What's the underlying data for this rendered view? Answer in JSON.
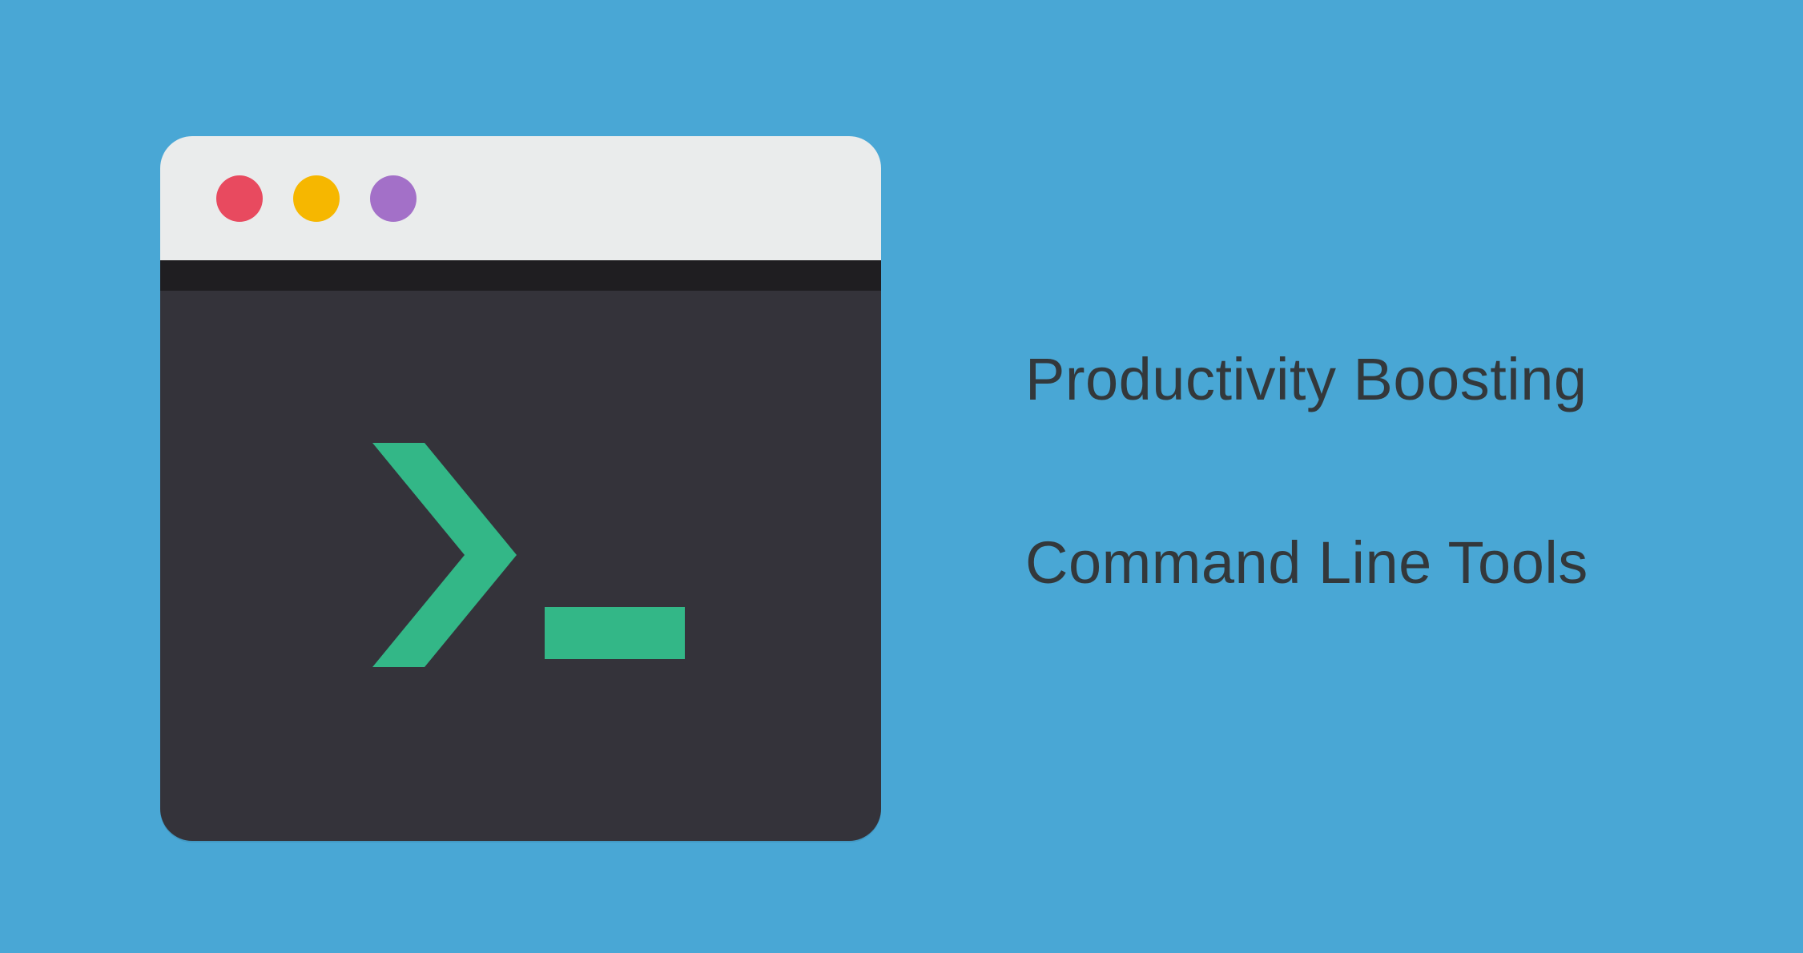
{
  "heading": {
    "line1": "Productivity Boosting",
    "line2": "Command Line Tools"
  },
  "colors": {
    "background": "#49a7d5",
    "titlebar": "#eaecec",
    "terminal_body": "#34333a",
    "prompt_green": "#33b787",
    "dot_red": "#e84a5f",
    "dot_yellow": "#f6b700",
    "dot_purple": "#a370c8",
    "text": "#33383b"
  },
  "icons": {
    "window_dots": [
      "close",
      "minimize",
      "zoom"
    ],
    "prompt": "prompt-chevron"
  }
}
